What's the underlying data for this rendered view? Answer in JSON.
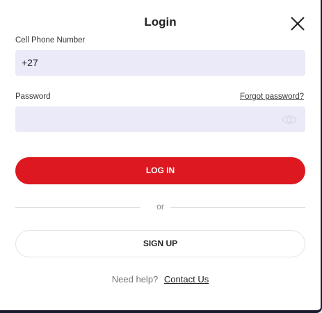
{
  "modal": {
    "title": "Login",
    "close_icon": "close-icon"
  },
  "phone": {
    "label": "Cell Phone Number",
    "value": "+27"
  },
  "password": {
    "label": "Password",
    "forgot_label": "Forgot password?",
    "value": "",
    "toggle_icon": "eye-icon"
  },
  "actions": {
    "login_label": "LOG IN",
    "divider_text": "or",
    "signup_label": "SIGN UP"
  },
  "help": {
    "prompt": "Need help?",
    "contact_label": "Contact Us"
  },
  "colors": {
    "primary": "#dd1820",
    "input_bg": "#ebeaf8"
  }
}
